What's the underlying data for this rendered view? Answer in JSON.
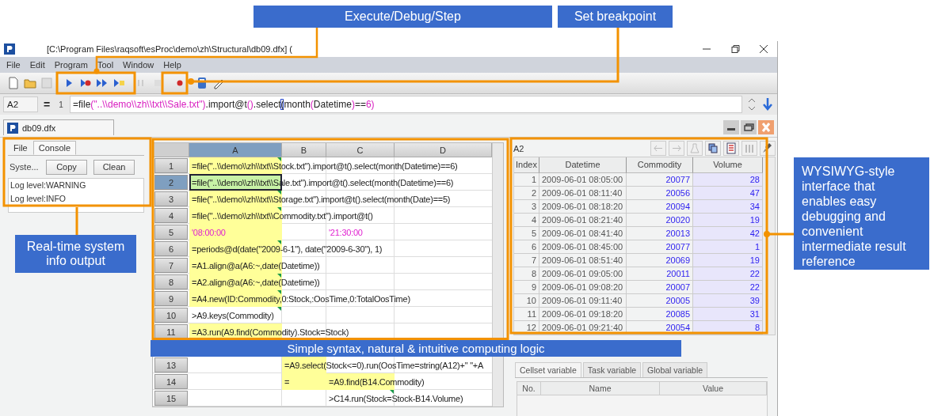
{
  "annotations": [
    {
      "text": "Execute/Debug/Step"
    },
    {
      "text": "Set breakpoint"
    },
    {
      "text": "Real-time system info output"
    },
    {
      "text": "Simple syntax, natural & intuitive computing logic"
    },
    {
      "text": "WYSIWYG-style interface that enables easy debugging and convenient intermediate result reference"
    }
  ],
  "window": {
    "title": "[C:\\Program Files\\raqsoft\\esProc\\demo\\zh\\Structural\\db09.dfx] ("
  },
  "menu": [
    "File",
    "Edit",
    "Program",
    "Tool",
    "Window",
    "Help"
  ],
  "formula_bar": {
    "cell": "A2",
    "equals": "=",
    "line": "1",
    "segments": [
      {
        "text": "=file",
        "kind": "code"
      },
      {
        "text": "(\"..\\\\demo\\\\zh\\\\txt\\\\Sale.txt\")",
        "kind": "literal"
      },
      {
        "text": ".import@t",
        "kind": "code"
      },
      {
        "text": "()",
        "kind": "literal"
      },
      {
        "text": ".select",
        "kind": "code"
      },
      {
        "text": "(",
        "kind": "match"
      },
      {
        "text": "month",
        "kind": "code"
      },
      {
        "text": "(",
        "kind": "literal"
      },
      {
        "text": "Datetime",
        "kind": "code"
      },
      {
        "text": ")",
        "kind": "literal"
      },
      {
        "text": "==",
        "kind": "code"
      },
      {
        "text": "6)",
        "kind": "literal"
      }
    ]
  },
  "document_tab": "db09.dfx",
  "left_panel": {
    "tabs": [
      {
        "label": "File",
        "selected": false
      },
      {
        "label": "Console",
        "selected": true
      }
    ],
    "label": "Syste...",
    "buttons": [
      "Copy",
      "Clean"
    ],
    "log": [
      "Log level:WARNING",
      "Log level:INFO"
    ]
  },
  "grid": {
    "columns": [
      {
        "label": "A",
        "selected": true
      },
      {
        "label": "B",
        "selected": false
      },
      {
        "label": "C",
        "selected": false
      },
      {
        "label": "D",
        "selected": false
      }
    ],
    "rows": [
      {
        "number": "1",
        "selected": false,
        "cells": [
          {
            "text": "=file(\"..\\\\demo\\\\zh\\\\txt\\\\Stock.txt\").import@t().select(month(Datetime)==6)",
            "kind": "formula",
            "shaded": true,
            "flag": true,
            "selected": false
          },
          {
            "text": ""
          },
          {
            "text": ""
          },
          {
            "text": ""
          }
        ]
      },
      {
        "number": "2",
        "selected": true,
        "cells": [
          {
            "text": "=file(\"..\\\\demo\\\\zh\\\\txt\\\\Sale.txt\").import@t().select(month(Datetime)==6)",
            "kind": "formula",
            "shaded": true,
            "flag": false,
            "selected": true
          },
          {
            "text": ""
          },
          {
            "text": ""
          },
          {
            "text": ""
          }
        ]
      },
      {
        "number": "3",
        "selected": false,
        "cells": [
          {
            "text": "=file(\"..\\\\demo\\\\zh\\\\txt\\\\Storage.txt\").import@t().select(month(Date)==5)",
            "kind": "formula",
            "shaded": true,
            "flag": true,
            "selected": false
          },
          {
            "text": ""
          },
          {
            "text": ""
          },
          {
            "text": ""
          }
        ]
      },
      {
        "number": "4",
        "selected": false,
        "cells": [
          {
            "text": "=file(\"..\\\\demo\\\\zh\\\\txt\\\\Commodity.txt\").import@t()",
            "kind": "formula",
            "shaded": true,
            "flag": true,
            "selected": false
          },
          {
            "text": ""
          },
          {
            "text": ""
          },
          {
            "text": ""
          }
        ]
      },
      {
        "number": "5",
        "selected": false,
        "cells": [
          {
            "text": "'08:00:00",
            "kind": "constant",
            "shaded": true,
            "flag": false,
            "selected": false
          },
          {
            "text": ""
          },
          {
            "text": "'21:30:00",
            "kind": "constant",
            "shaded": false,
            "flag": false,
            "selected": false
          },
          {
            "text": ""
          }
        ]
      },
      {
        "number": "6",
        "selected": false,
        "cells": [
          {
            "text": "=periods@d(date(\"2009-6-1\"), date(\"2009-6-30\"), 1)",
            "kind": "formula",
            "shaded": true,
            "flag": true,
            "selected": false
          },
          {
            "text": ""
          },
          {
            "text": ""
          },
          {
            "text": ""
          }
        ]
      },
      {
        "number": "7",
        "selected": false,
        "cells": [
          {
            "text": "=A1.align@a(A6:~,date(Datetime))",
            "kind": "formula",
            "shaded": true,
            "flag": false,
            "selected": false
          },
          {
            "text": ""
          },
          {
            "text": ""
          },
          {
            "text": ""
          }
        ]
      },
      {
        "number": "8",
        "selected": false,
        "cells": [
          {
            "text": "=A2.align@a(A6:~,date(Datetime))",
            "kind": "formula",
            "shaded": true,
            "flag": true,
            "selected": false
          },
          {
            "text": ""
          },
          {
            "text": ""
          },
          {
            "text": ""
          }
        ]
      },
      {
        "number": "9",
        "selected": false,
        "cells": [
          {
            "text": "=A4.new(ID:Commodity,0:Stock,:OosTime,0:TotalOosTime)",
            "kind": "formula",
            "shaded": true,
            "flag": true,
            "selected": false
          },
          {
            "text": ""
          },
          {
            "text": ""
          },
          {
            "text": ""
          }
        ]
      },
      {
        "number": "10",
        "selected": false,
        "cells": [
          {
            "text": ">A9.keys(Commodity)",
            "kind": "statement",
            "shaded": false,
            "flag": true,
            "selected": false
          },
          {
            "text": ""
          },
          {
            "text": ""
          },
          {
            "text": ""
          }
        ]
      },
      {
        "number": "11",
        "selected": false,
        "cells": [
          {
            "text": "=A3.run(A9.find(Commodity).Stock=Stock)",
            "kind": "formula",
            "shaded": true,
            "flag": false,
            "selected": false
          },
          {
            "text": ""
          },
          {
            "text": ""
          },
          {
            "text": ""
          }
        ]
      },
      {
        "number": "13",
        "selected": false,
        "cells": [
          {
            "text": ""
          },
          {
            "text": "=A9.select(Stock<=0).run(OosTime=string(A12)+\" \"+A",
            "kind": "formula",
            "shaded": true,
            "flag": false,
            "selected": false
          },
          {
            "text": ""
          },
          {
            "text": ""
          }
        ]
      },
      {
        "number": "14",
        "selected": false,
        "cells": [
          {
            "text": ""
          },
          {
            "text": "=",
            "kind": "formula",
            "shaded": true,
            "flag": false,
            "selected": false
          },
          {
            "text": "=A9.find(B14.Commodity)",
            "kind": "formula",
            "shaded": true,
            "flag": false,
            "selected": false
          },
          {
            "text": ""
          }
        ]
      },
      {
        "number": "15",
        "selected": false,
        "cells": [
          {
            "text": ""
          },
          {
            "text": ""
          },
          {
            "text": ">C14.run(Stock=Stock-B14.Volume)",
            "kind": "statement",
            "shaded": false,
            "flag": true,
            "selected": false
          },
          {
            "text": ""
          }
        ]
      }
    ]
  },
  "result": {
    "cell": "A2",
    "columns": [
      "Index",
      "Datetime",
      "Commodity",
      "Volume"
    ],
    "rows": [
      [
        "1",
        "2009-06-01 08:05:00",
        "20077",
        "28"
      ],
      [
        "2",
        "2009-06-01 08:11:40",
        "20056",
        "47"
      ],
      [
        "3",
        "2009-06-01 08:18:20",
        "20094",
        "34"
      ],
      [
        "4",
        "2009-06-01 08:21:40",
        "20020",
        "19"
      ],
      [
        "5",
        "2009-06-01 08:41:40",
        "20013",
        "42"
      ],
      [
        "6",
        "2009-06-01 08:45:00",
        "20077",
        "1"
      ],
      [
        "7",
        "2009-06-01 08:51:40",
        "20069",
        "19"
      ],
      [
        "8",
        "2009-06-01 09:05:00",
        "20011",
        "22"
      ],
      [
        "9",
        "2009-06-01 09:08:20",
        "20007",
        "22"
      ],
      [
        "10",
        "2009-06-01 09:11:40",
        "20005",
        "39"
      ],
      [
        "11",
        "2009-06-01 09:18:20",
        "20085",
        "31"
      ],
      [
        "12",
        "2009-06-01 09:21:40",
        "20054",
        "8"
      ]
    ]
  },
  "variables": {
    "tabs": [
      {
        "label": "Cellset variable",
        "selected": true
      },
      {
        "label": "Task variable",
        "selected": false
      },
      {
        "label": "Global variable",
        "selected": false
      }
    ],
    "columns": [
      "No.",
      "Name",
      "Value"
    ]
  }
}
